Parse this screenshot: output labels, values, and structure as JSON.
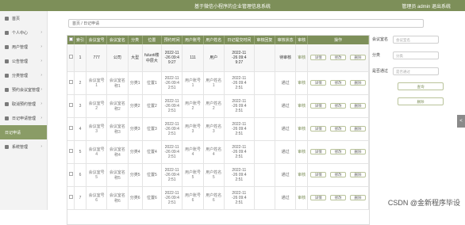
{
  "header": {
    "title": "基于微信小程序的企业管理信息系统",
    "user": "管理员 admin  退出系统"
  },
  "sidebar": {
    "items": [
      {
        "label": "首页",
        "icon": "home-icon"
      },
      {
        "label": "个人中心",
        "icon": "user-icon"
      },
      {
        "label": "用户管理",
        "icon": "user-icon"
      },
      {
        "label": "公告管理",
        "icon": "notice-icon"
      },
      {
        "label": "分类管理",
        "icon": "category-icon"
      },
      {
        "label": "预约会议室管理",
        "icon": "meeting-icon"
      },
      {
        "label": "取消预约管理",
        "icon": "cancel-icon"
      },
      {
        "label": "日记申请管理",
        "icon": "diary-icon"
      },
      {
        "label": "日记申请",
        "icon": "",
        "active": true
      },
      {
        "label": "系统管理",
        "icon": "gear-icon"
      }
    ]
  },
  "breadcrumb": "首页 / 日记申请",
  "table": {
    "headers": [
      "",
      "索引",
      "会议室号",
      "会议室名",
      "分类",
      "位置",
      "预约时间",
      "用户账号",
      "用户姓名",
      "日记提交时间",
      "审核回复",
      "审核状态",
      "审核",
      "操作"
    ],
    "rows": [
      {
        "idx": "1",
        "num": "777",
        "name": "公司",
        "cat": "大型",
        "loc": "fuluoti楼\n中层大",
        "time": "2022-11\n-26 09:4\n9:27",
        "acc": "111",
        "uname": "用户",
        "tm": "2022-11\n-26 09:4\n9:27",
        "reply": "",
        "st": "待审核",
        "audit": "审核"
      },
      {
        "idx": "2",
        "num": "会议室号\n1",
        "name": "会议室名\n称1",
        "cat": "分类1",
        "loc": "位置1",
        "time": "2022-11\n-26 09:4\n2:51",
        "acc": "用户账号\n1",
        "uname": "用户姓名\n1",
        "tm": "2022-11\n-26 09:4\n2:51",
        "reply": "",
        "st": "通过",
        "audit": "审核"
      },
      {
        "idx": "3",
        "num": "会议室号\n2",
        "name": "会议室名\n称2",
        "cat": "分类2",
        "loc": "位置2",
        "time": "2022-11\n-26 09:4\n2:51",
        "acc": "用户账号\n2",
        "uname": "用户姓名\n2",
        "tm": "2022-11\n-26 09:4\n2:51",
        "reply": "",
        "st": "通过",
        "audit": "审核"
      },
      {
        "idx": "4",
        "num": "会议室号\n3",
        "name": "会议室名\n称3",
        "cat": "分类3",
        "loc": "位置3",
        "time": "2022-11\n-26 09:4\n2:51",
        "acc": "用户账号\n3",
        "uname": "用户姓名\n3",
        "tm": "2022-11\n-26 09:4\n2:51",
        "reply": "",
        "st": "通过",
        "audit": "审核"
      },
      {
        "idx": "5",
        "num": "会议室号\n4",
        "name": "会议室名\n称4",
        "cat": "分类4",
        "loc": "位置4",
        "time": "2022-11\n-26 09:4\n2:51",
        "acc": "用户账号\n4",
        "uname": "用户姓名\n4",
        "tm": "2022-11\n-26 09:4\n2:51",
        "reply": "",
        "st": "通过",
        "audit": "审核"
      },
      {
        "idx": "6",
        "num": "会议室号\n5",
        "name": "会议室名\n称5",
        "cat": "分类5",
        "loc": "位置5",
        "time": "2022-11\n-26 09:4\n2:51",
        "acc": "用户账号\n5",
        "uname": "用户姓名\n5",
        "tm": "2022-11\n-26 09:4\n2:51",
        "reply": "",
        "st": "通过",
        "audit": "审核"
      },
      {
        "idx": "7",
        "num": "会议室号\n6",
        "name": "会议室名\n称6",
        "cat": "分类6",
        "loc": "位置6",
        "time": "2022-11\n-26 09:4\n2:51",
        "acc": "用户账号\n6",
        "uname": "用户姓名\n6",
        "tm": "2022-11\n-26 09:4\n2:51",
        "reply": "",
        "st": "通过",
        "audit": "审核"
      }
    ],
    "row_buttons": [
      "详情",
      "修改",
      "删除"
    ]
  },
  "filter": {
    "room_label": "会议室名",
    "room_placeholder": "会议室名",
    "cat_label": "分类",
    "cat_placeholder": "分类",
    "status_label": "是否通过",
    "status_placeholder": "是否通过",
    "search_btn": "查询",
    "delete_btn": "删除"
  },
  "side_tab": "<",
  "watermark": "CSDN @金新程序毕设"
}
